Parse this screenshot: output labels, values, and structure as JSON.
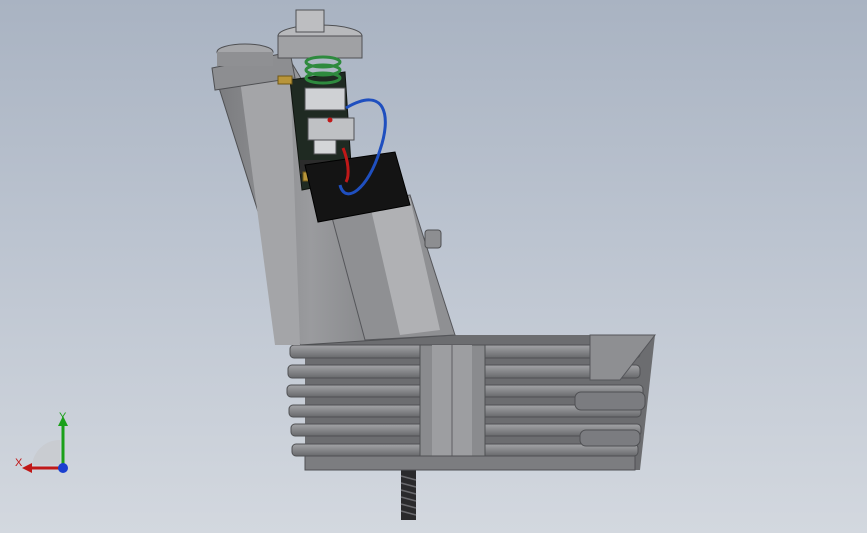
{
  "viewport": {
    "background_top": "#a9b3c2",
    "background_bottom": "#d3d8df"
  },
  "model": {
    "body_color": "#8c8d90",
    "body_shadow": "#6e6f72",
    "body_highlight": "#b8b9bc",
    "fin_color": "#7f8084",
    "black_block": "#141414",
    "wire_blue": "#1f4fbf",
    "wire_red": "#c01818",
    "spring_green": "#2e8a3e",
    "brass": "#b8953a"
  },
  "triad": {
    "y_label": "Y",
    "x_label": "X",
    "y_color": "#1aa01a",
    "x_color": "#c01818",
    "z_color": "#1a3fd0"
  }
}
